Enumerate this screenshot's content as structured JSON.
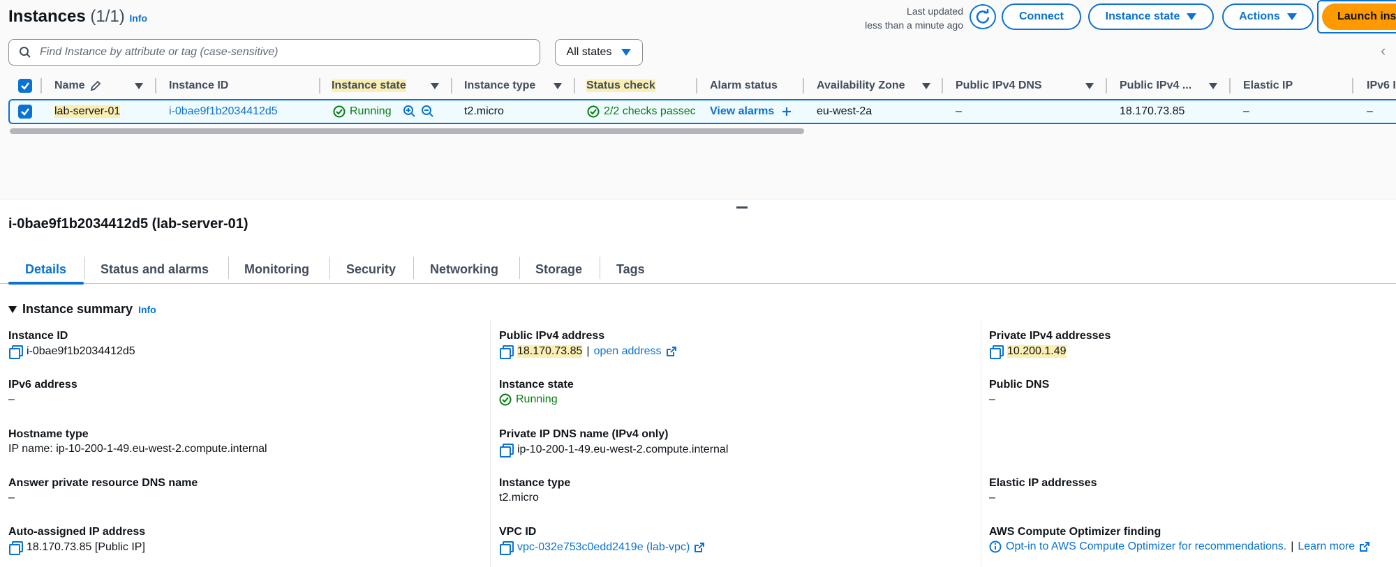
{
  "header": {
    "title": "Instances",
    "count": "(1/1)",
    "info": "Info",
    "last_updated_line1": "Last updated",
    "last_updated_line2": "less than a minute ago",
    "connect": "Connect",
    "instance_state": "Instance state",
    "actions": "Actions",
    "launch": "Launch ins"
  },
  "search": {
    "placeholder": "Find Instance by attribute or tag (case-sensitive)"
  },
  "states_filter": "All states",
  "table": {
    "columns": [
      "Name",
      "Instance ID",
      "Instance state",
      "Instance type",
      "Status check",
      "Alarm status",
      "Availability Zone",
      "Public IPv4 DNS",
      "Public IPv4 ...",
      "Elastic IP",
      "IPv6 I"
    ],
    "row": {
      "name": "lab-server-01",
      "instance_id": "i-0bae9f1b2034412d5",
      "state": "Running",
      "type": "t2.micro",
      "status_check": "2/2 checks passec",
      "alarm": "View alarms",
      "az": "eu-west-2a",
      "public_dns": "–",
      "public_ip": "18.170.73.85",
      "elastic_ip": "–",
      "ipv6": "–"
    }
  },
  "details": {
    "title": "i-0bae9f1b2034412d5 (lab-server-01)",
    "tabs": [
      "Details",
      "Status and alarms",
      "Monitoring",
      "Security",
      "Networking",
      "Storage",
      "Tags"
    ],
    "section": "Instance summary",
    "section_info": "Info",
    "col1": [
      {
        "label": "Instance ID",
        "value": "i-0bae9f1b2034412d5"
      },
      {
        "label": "IPv6 address",
        "value": "–"
      },
      {
        "label": "Hostname type",
        "value": "IP name: ip-10-200-1-49.eu-west-2.compute.internal"
      },
      {
        "label": "Answer private resource DNS name",
        "value": "–"
      },
      {
        "label": "Auto-assigned IP address",
        "value": "18.170.73.85 [Public IP]"
      }
    ],
    "col2": [
      {
        "label": "Public IPv4 address",
        "value": "18.170.73.85",
        "link": "open address"
      },
      {
        "label": "Instance state",
        "value": "Running"
      },
      {
        "label": "Private IP DNS name (IPv4 only)",
        "value": "ip-10-200-1-49.eu-west-2.compute.internal"
      },
      {
        "label": "Instance type",
        "value": "t2.micro"
      },
      {
        "label": "VPC ID",
        "value": "vpc-032e753c0edd2419e (lab-vpc)"
      }
    ],
    "col3": [
      {
        "label": "Private IPv4 addresses",
        "value": "10.200.1.49"
      },
      {
        "label": "Public DNS",
        "value": "–"
      },
      {
        "label": "Elastic IP addresses",
        "value": "–"
      },
      {
        "label": "AWS Compute Optimizer finding",
        "value": "Opt-in to AWS Compute Optimizer for recommendations.",
        "sep": "|",
        "link": "Learn more"
      }
    ]
  },
  "colors": {
    "accent": "#0972d3",
    "launch": "#ff9900",
    "highlight": "#fbeeb2",
    "running": "#037f0c"
  }
}
